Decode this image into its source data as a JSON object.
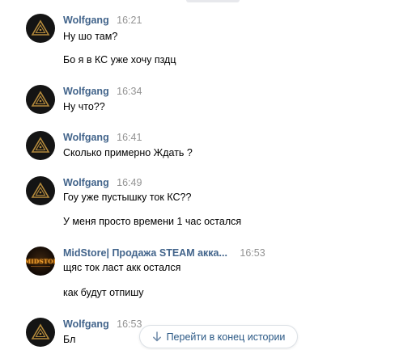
{
  "messages": [
    {
      "author": "Wolfgang",
      "time": "16:21",
      "avatar": "wolf-logo",
      "lines": [
        "Ну шо там?",
        "Бо я в КС уже хочу пздц"
      ]
    },
    {
      "author": "Wolfgang",
      "time": "16:34",
      "avatar": "wolf-logo",
      "lines": [
        "Ну что??"
      ]
    },
    {
      "author": "Wolfgang",
      "time": "16:41",
      "avatar": "wolf-logo",
      "lines": [
        "Сколько примерно Ждать ?"
      ]
    },
    {
      "author": "Wolfgang",
      "time": "16:49",
      "avatar": "wolf-logo",
      "lines": [
        "Гоу уже пустышку ток КС??",
        "У меня просто времени 1 час остался"
      ]
    },
    {
      "author": "MidStore| Продажа STEAM акка...",
      "time": "16:53",
      "avatar": "midstore-logo",
      "avatar_text": "MIDSTORE",
      "lines": [
        "щяс ток ласт акк остался",
        "как будут отпишу"
      ]
    },
    {
      "author": "Wolfgang",
      "time": "16:53",
      "avatar": "wolf-logo",
      "lines": [
        "Бл"
      ]
    }
  ],
  "jump_button": {
    "label": "Перейти в конец истории",
    "icon": "arrow-down-icon"
  },
  "colors": {
    "author": "#42648b",
    "time": "#939393",
    "link": "#2a5885",
    "text": "#000000"
  }
}
